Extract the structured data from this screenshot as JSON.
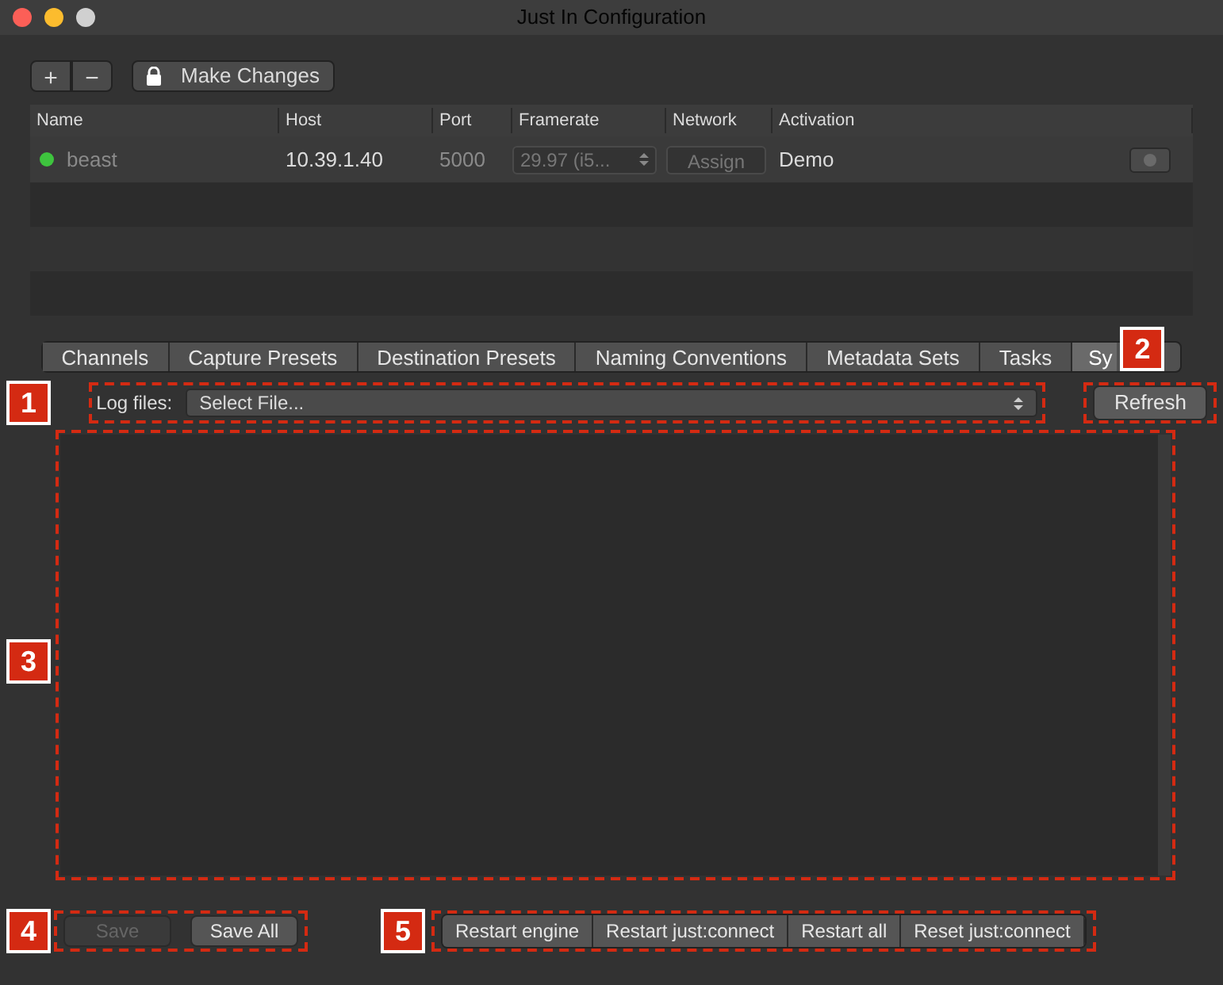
{
  "window": {
    "title": "Just In Configuration"
  },
  "toolbar": {
    "add": "+",
    "remove": "−",
    "make_changes": "Make Changes"
  },
  "table": {
    "columns": [
      "Name",
      "Host",
      "Port",
      "Framerate",
      "Network",
      "Activation"
    ],
    "rows": [
      {
        "name": "beast",
        "color": "#3ec43e",
        "host": "10.39.1.40",
        "port": "5000",
        "framerate": "29.97 (i5...",
        "network": "Assign",
        "activation": "Demo"
      }
    ]
  },
  "tabs": [
    {
      "label": "Channels",
      "selected": false
    },
    {
      "label": "Capture Presets",
      "selected": false
    },
    {
      "label": "Destination Presets",
      "selected": false
    },
    {
      "label": "Naming Conventions",
      "selected": false
    },
    {
      "label": "Metadata Sets",
      "selected": false
    },
    {
      "label": "Tasks",
      "selected": false
    },
    {
      "label": "Sy",
      "selected": true
    }
  ],
  "log": {
    "label": "Log files:",
    "select": "Select File...",
    "refresh": "Refresh"
  },
  "save_buttons": [
    {
      "label": "Save",
      "disabled": true
    },
    {
      "label": "Save All",
      "disabled": false
    }
  ],
  "restart_buttons": [
    "Restart engine",
    "Restart just:connect",
    "Restart all",
    "Reset just:connect"
  ],
  "callouts": [
    "1",
    "2",
    "3",
    "4",
    "5"
  ]
}
